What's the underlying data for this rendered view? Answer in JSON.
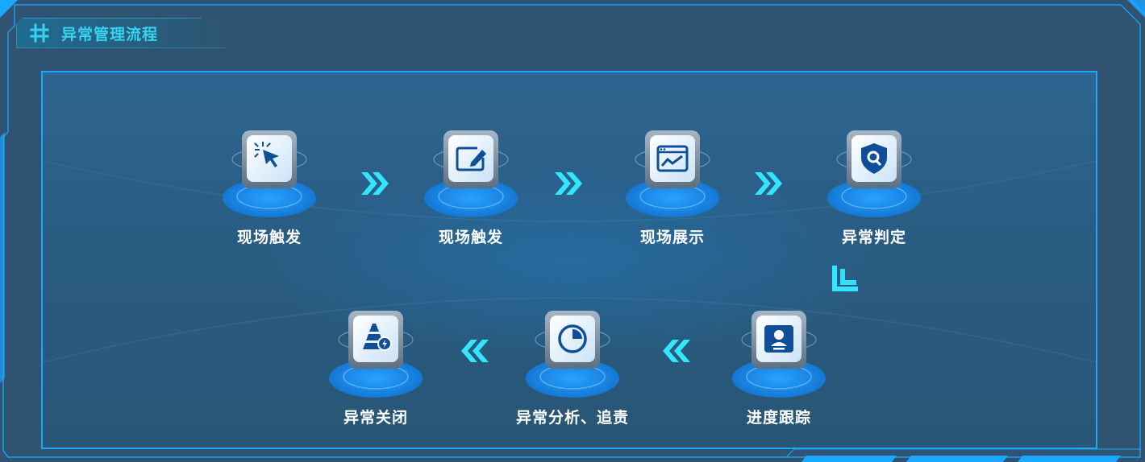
{
  "header": {
    "title": "异常管理流程"
  },
  "flow": {
    "steps": [
      {
        "label": "现场触发",
        "icon": "cursor-click-icon"
      },
      {
        "label": "现场触发",
        "icon": "edit-window-icon"
      },
      {
        "label": "现场展示",
        "icon": "chart-window-icon"
      },
      {
        "label": "异常判定",
        "icon": "shield-search-icon"
      },
      {
        "label": "进度跟踪",
        "icon": "person-card-icon"
      },
      {
        "label": "异常分析、追责",
        "icon": "pie-chart-icon"
      },
      {
        "label": "异常关闭",
        "icon": "pyramid-alert-icon"
      }
    ]
  },
  "colors": {
    "accent": "#36d3f3",
    "border": "#1aa7ff",
    "disk": "#1f8fe8",
    "background": "#2f5370"
  }
}
